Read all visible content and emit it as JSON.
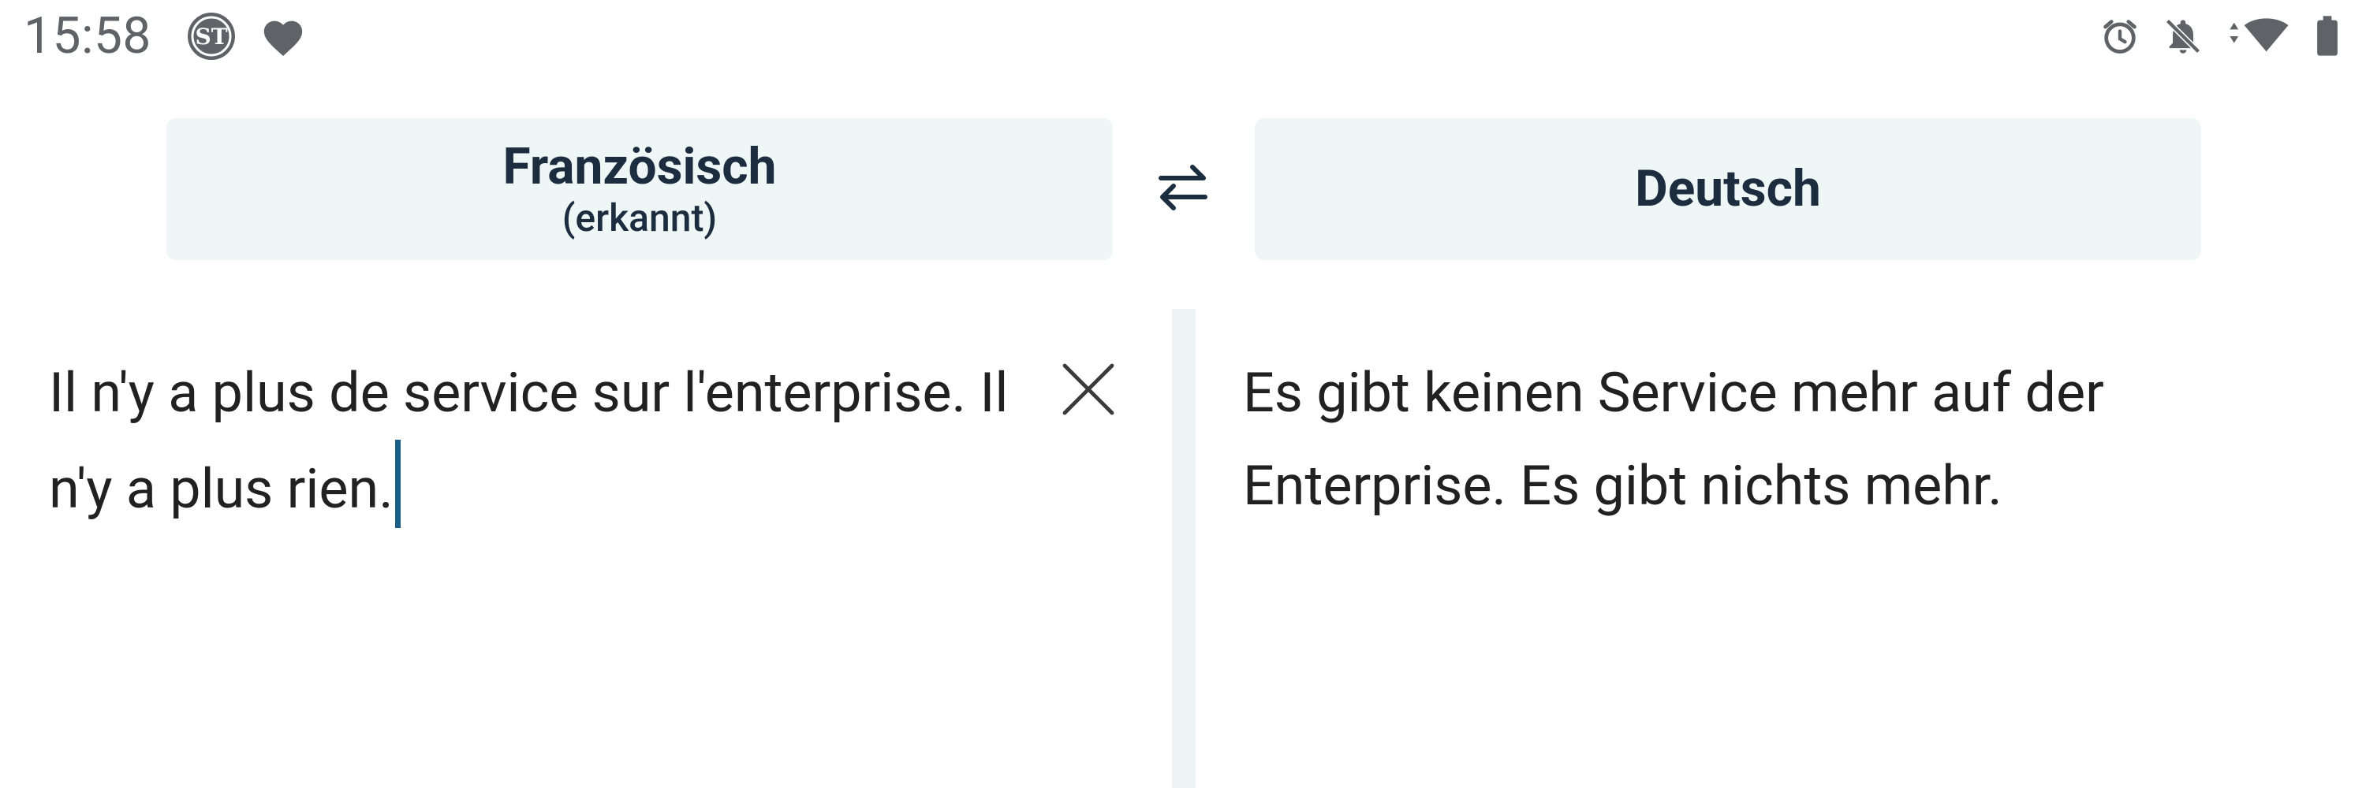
{
  "status_bar": {
    "time": "15:58",
    "left_icons": [
      "st-app-icon",
      "heart-icon"
    ],
    "right_icons": [
      "alarm-icon",
      "notifications-off-icon",
      "wifi-data-icon",
      "battery-icon"
    ]
  },
  "languages": {
    "source": {
      "name": "Französisch",
      "detected_label": "(erkannt)"
    },
    "swap_icon": "swap-horizontal-icon",
    "target": {
      "name": "Deutsch"
    }
  },
  "source_pane": {
    "text": "Il n'y a plus de service sur l'enterprise. Il n'y a plus rien.",
    "clear_icon": "close-icon"
  },
  "target_pane": {
    "text": "Es gibt keinen Service mehr auf der Enterprise. Es gibt nichts mehr."
  },
  "colors": {
    "accent": "#1b5f86",
    "language_button_bg": "#eef6f6",
    "language_text": "#1c2d40",
    "divider": "#eef3f6",
    "body_text": "#212121"
  }
}
